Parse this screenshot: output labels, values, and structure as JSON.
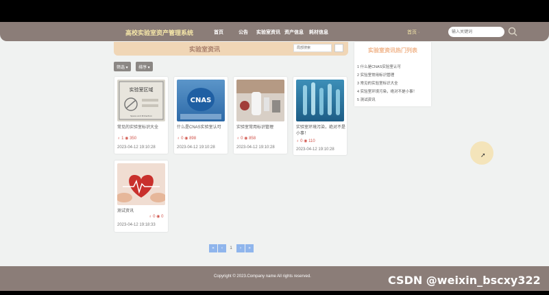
{
  "nav": {
    "brand": "高校实验室资产管理系统",
    "links": [
      "首页",
      "公告",
      "实验室资讯",
      "资产信息",
      "耗材信息"
    ],
    "home_right": "首页 ·",
    "search_placeholder": "输入关键词"
  },
  "news": {
    "title": "实验室资讯",
    "search_placeholder": "局部搜索",
    "filters": [
      "筛选 ▾",
      "排序 ▾"
    ]
  },
  "cards": [
    {
      "title": "常见的实验室标识大全",
      "likes": "1",
      "views": "350",
      "date": "2023-04-12 19:10:28"
    },
    {
      "title": "什么是CNAS实验室认可",
      "likes": "0",
      "views": "898",
      "date": "2023-04-12 19:10:28"
    },
    {
      "title": "实验室常用标识管理",
      "likes": "0",
      "views": "858",
      "date": "2023-04-12 19:10:28"
    },
    {
      "title": "实验室环境污染，绝对不是小事！",
      "likes": "0",
      "views": "110",
      "date": "2023-04-12 19:10:28"
    },
    {
      "title": "测试资讯",
      "likes": "0",
      "views": "0",
      "date": "2023-04-12 19:18:33"
    }
  ],
  "thumb_text": {
    "lab_sign": "实验室区域",
    "cnas": "CNAS",
    "lab_sign_note": "Space and Protection"
  },
  "hot": {
    "title": "实验室资讯热门列表",
    "items": [
      "1  什么是CNAS实验室认可",
      "2  实验室常用标识管理",
      "3  常见的实验室标识大全",
      "4  实验室环境污染，绝对不是小事！",
      "5  测试资讯"
    ]
  },
  "pagination": {
    "prev2": "«",
    "prev": "‹",
    "current": "1",
    "next": "›",
    "next2": "»"
  },
  "footer": {
    "copyright": "Copyright © 2023.Company name All rights reserved.",
    "watermark": "CSDN @weixin_bscxy322"
  },
  "colors": {
    "nav_bg": "#8b7d78",
    "brand": "#f5e6a8",
    "header_band": "#f0d6b6",
    "accent_red": "#d0534a",
    "page_btn": "#8fb5ec"
  }
}
